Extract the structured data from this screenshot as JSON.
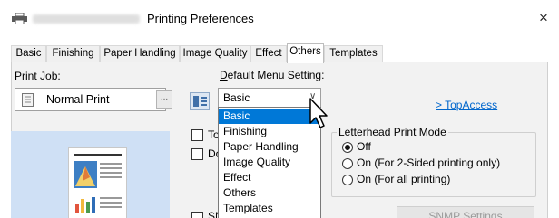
{
  "window": {
    "title": "Printing Preferences",
    "close_glyph": "×"
  },
  "tabs": [
    "Basic",
    "Finishing",
    "Paper Handling",
    "Image Quality",
    "Effect",
    "Others",
    "Templates"
  ],
  "active_tab": "Others",
  "print_job": {
    "label_pre": "Print ",
    "label_u": "J",
    "label_post": "ob:",
    "value": "Normal Print",
    "more_button": "..."
  },
  "default_menu": {
    "label_u": "D",
    "label_post": "efault Menu Setting:",
    "value": "Basic",
    "options": [
      "Basic",
      "Finishing",
      "Paper Handling",
      "Image Quality",
      "Effect",
      "Others",
      "Templates"
    ],
    "selected_option": "Basic"
  },
  "checkboxes": {
    "first_fragment": "To",
    "second_fragment": "Do",
    "third_fragment": "SN"
  },
  "topaccess_link": "> TopAccess",
  "letterhead": {
    "legend_pre": "Letter",
    "legend_u": "h",
    "legend_post": "ead Print Mode",
    "options": [
      "Off",
      "On (For 2-Sided printing only)",
      "On (For all printing)"
    ],
    "selected": "Off"
  },
  "snmp_button": "SNMP Settings",
  "colors": {
    "accent": "#0078d7",
    "link": "#0066cc",
    "preview_bg": "#cfe0f5"
  }
}
